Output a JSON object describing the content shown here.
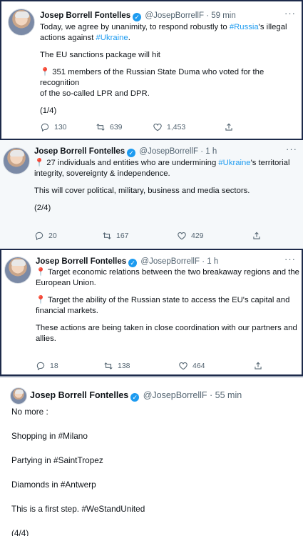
{
  "tweets": [
    {
      "name": "Josep Borrell Fontelles",
      "handle": "@JosepBorrellF",
      "time": "· 59 min",
      "line1_a": "Today, we agree by unanimity, to respond robustly to ",
      "line1_tag": "#Russia",
      "line1_b": "'s illegal",
      "line2_a": "actions against ",
      "line2_tag": "#Ukraine",
      "line2_b": ".",
      "para2": "The EU sanctions package will hit",
      "pin_line1": " 351 members of the Russian State Duma who voted for the recognition",
      "pin_line2": "of the so-called LPR and DPR.",
      "counter": "(1/4)",
      "replies": "130",
      "retweets": "639",
      "likes": "1,453"
    },
    {
      "name": "Josep Borrell Fontelles",
      "handle": "@JosepBorrellF",
      "time": "· 1 h",
      "line1_a": " 27 individuals and entities who are undermining ",
      "line1_tag": "#Ukraine",
      "line1_b": "'s territorial",
      "line2": "integrity, sovereignty & independence.",
      "para2": "This will cover political, military, business and media sectors.",
      "counter": "(2/4)",
      "replies": "20",
      "retweets": "167",
      "likes": "429"
    },
    {
      "name": "Josep Borrell Fontelles",
      "handle": "@JosepBorrellF",
      "time": "· 1 h",
      "p1_line1": " Target economic relations between the two breakaway regions and the",
      "p1_line2": "European Union.",
      "p2_line1": " Target the ability of the Russian state to access the EU's capital and",
      "p2_line2": "financial markets.",
      "p3_line1": "These actions are being taken in close coordination with our partners and",
      "p3_line2": "allies.",
      "replies": "18",
      "retweets": "138",
      "likes": "464"
    },
    {
      "name": "Josep Borrell Fontelles",
      "handle": "@JosepBorrellF",
      "time": "· 55 min",
      "l1": "No more :",
      "l2": "Shopping in #Milano",
      "l3": "Partying in #SaintTropez",
      "l4": "Diamonds in #Antwerp",
      "l5": "This is a first step. #WeStandUnited",
      "l6": "(4/4)"
    }
  ],
  "icons": {
    "reply": "reply-icon",
    "retweet": "retweet-icon",
    "like": "heart-icon",
    "share": "share-icon",
    "pin": "pushpin-icon",
    "more": "more-icon"
  },
  "colors": {
    "link": "#1d9bf0",
    "text": "#0f1419",
    "muted": "#536471",
    "pin": "#e0245e"
  }
}
